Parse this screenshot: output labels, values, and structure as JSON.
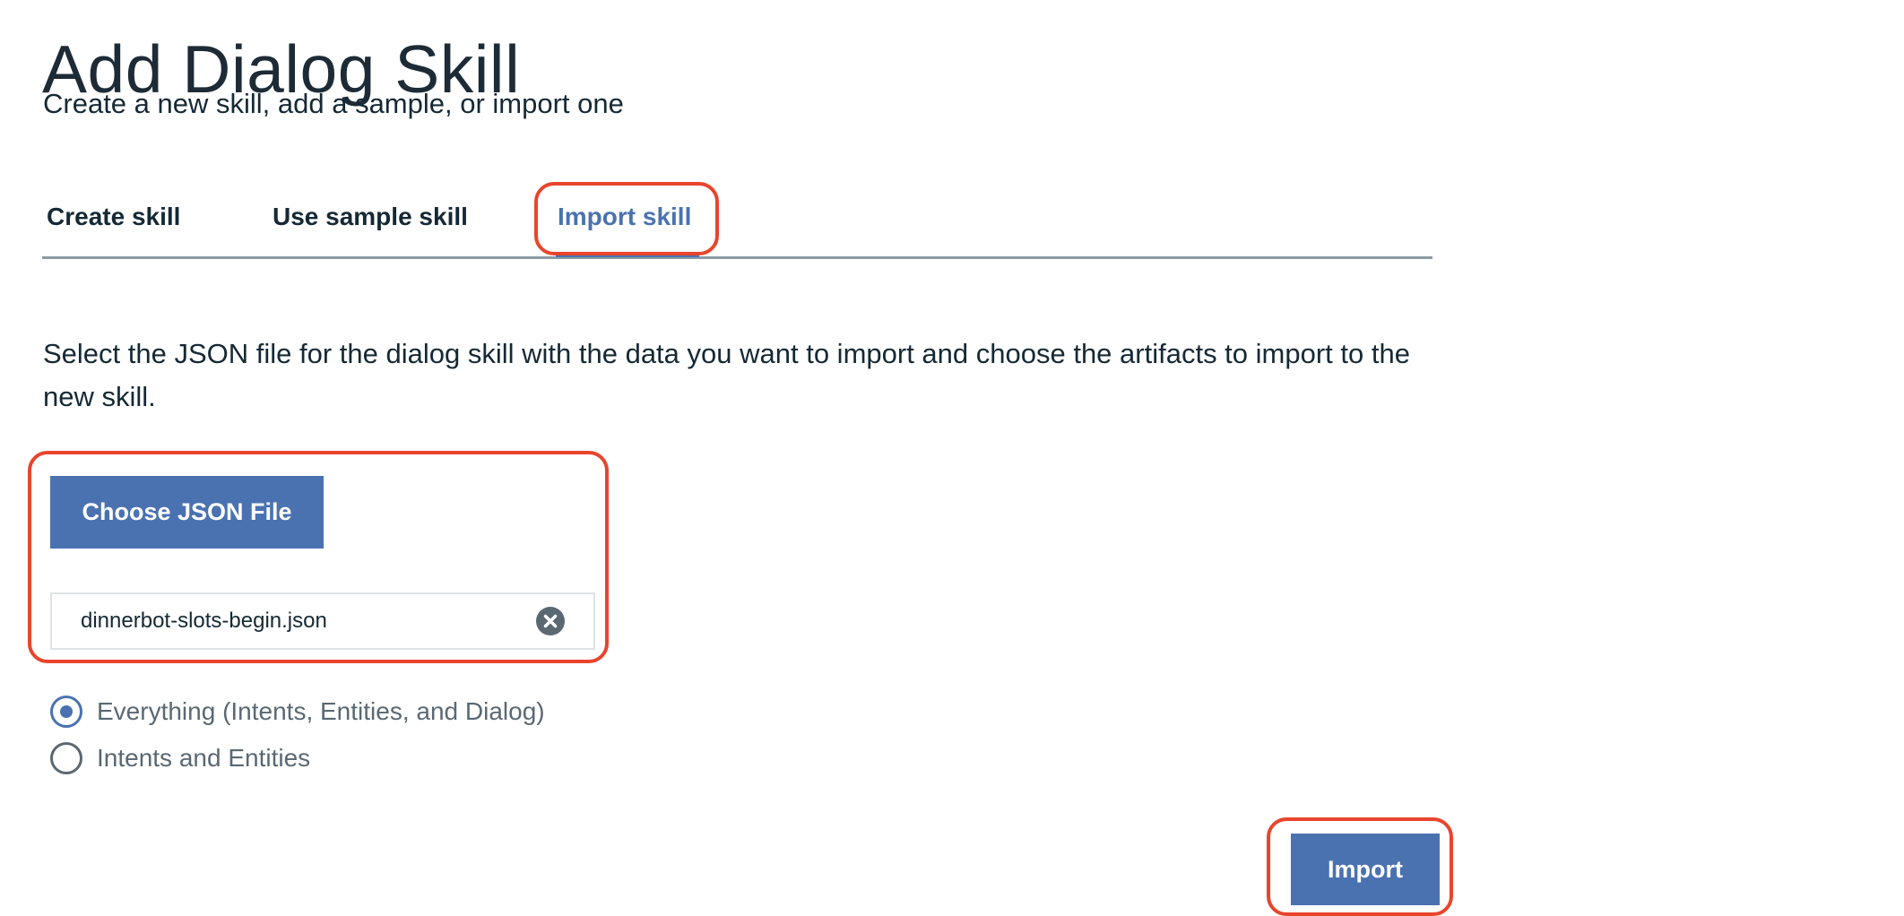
{
  "page": {
    "title": "Add Dialog Skill",
    "subtitle": "Create a new skill, add a sample, or import one"
  },
  "tabs": [
    {
      "label": "Create skill",
      "active": false
    },
    {
      "label": "Use sample skill",
      "active": false
    },
    {
      "label": "Import skill",
      "active": true
    }
  ],
  "import_panel": {
    "instruction": "Select the JSON file for the dialog skill with the data you want to import and choose the artifacts to import to the new skill.",
    "choose_button_label": "Choose JSON File",
    "file_name": "dinnerbot-slots-begin.json",
    "clear_icon": "close-circle-icon",
    "options": [
      {
        "label": "Everything (Intents, Entities, and Dialog)",
        "selected": true
      },
      {
        "label": "Intents and Entities",
        "selected": false
      }
    ],
    "import_button_label": "Import"
  },
  "colors": {
    "accent": "#4a72b0",
    "highlight": "#e8452c",
    "text": "#152935",
    "muted_text": "#5a6872",
    "tab_border": "#8c9ba5"
  }
}
